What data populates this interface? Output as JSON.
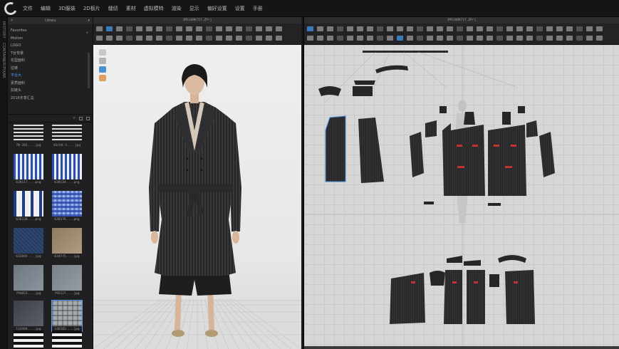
{
  "menu": {
    "items": [
      "文件",
      "编辑",
      "3D服装",
      "2D板片",
      "缝纫",
      "素材",
      "虚拟模特",
      "渲染",
      "显示",
      "偏好设置",
      "设置",
      "手册"
    ]
  },
  "vtabs": [
    "HISTORY",
    "CONTAINER/PIXAR"
  ],
  "library": {
    "title": "Library",
    "tree": [
      {
        "label": "Favorites",
        "active": false
      },
      {
        "label": "Motion",
        "active": false
      },
      {
        "label": "LOGO",
        "active": false
      },
      {
        "label": "T台背景",
        "active": false
      },
      {
        "label": "花型面料",
        "active": false
      },
      {
        "label": "拉链",
        "active": false
      },
      {
        "label": "平台大",
        "active": true
      },
      {
        "label": "素质面料",
        "active": false
      },
      {
        "label": "扣链头",
        "active": false
      },
      {
        "label": "2016冬季汇总",
        "active": false
      }
    ],
    "thumbs": [
      {
        "caption": "7W-201....jpg",
        "swatch": "top-stripes"
      },
      {
        "caption": "4G(H4-3....jpg",
        "swatch": "top-stripes-2"
      },
      {
        "caption": "638117....png",
        "swatch": "blue-stripes"
      },
      {
        "caption": "638134....png",
        "swatch": "blue-stripes-2"
      },
      {
        "caption": "638138....png",
        "swatch": "blue-bars"
      },
      {
        "caption": "638176....png",
        "swatch": "blue-plaid"
      },
      {
        "caption": "632045....jpg",
        "swatch": "navy-weave"
      },
      {
        "caption": "6345?5....jpg",
        "swatch": "tan-texture"
      },
      {
        "caption": "794053....jpg",
        "swatch": "grey-wool"
      },
      {
        "caption": "795127....jpg",
        "swatch": "grey-wool-2"
      },
      {
        "caption": "114484....jpg",
        "swatch": "dark-wool"
      },
      {
        "caption": "146101....jpg",
        "swatch": "grey-plaid"
      },
      {
        "caption": "",
        "swatch": "bw-stripe"
      },
      {
        "caption": "",
        "swatch": "bw-stripe-2"
      }
    ]
  },
  "view3d": {
    "title": "JMS16BK717.ZPrj"
  },
  "view2d": {
    "title": "JMS16BK717.ZPrj"
  },
  "colors": {
    "accent": "#4a9eff",
    "garment": "#262628",
    "pattern_outline_selected": "#3d8bd6"
  }
}
